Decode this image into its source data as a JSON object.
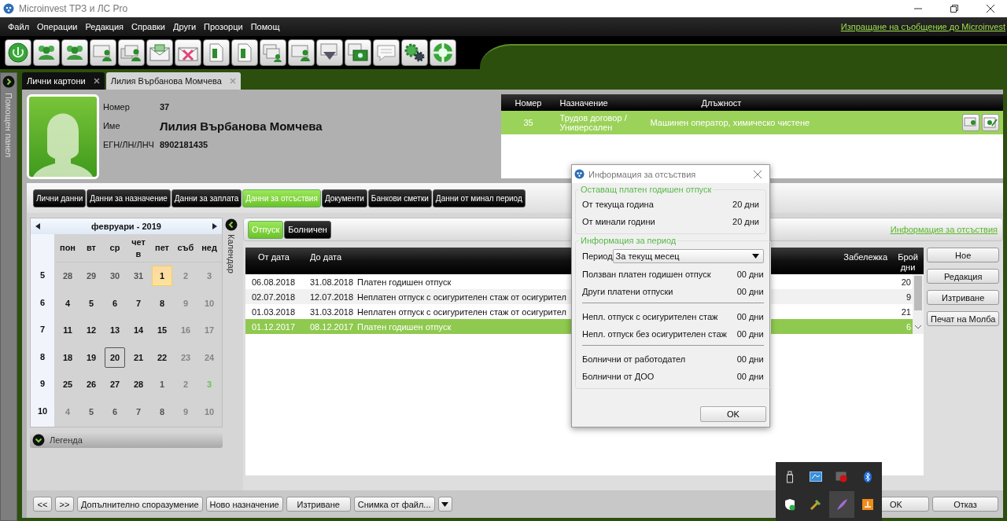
{
  "window": {
    "title": "Microinvest ТРЗ и ЛС Pro"
  },
  "menu": [
    "Файл",
    "Операции",
    "Редакция",
    "Справки",
    "Други",
    "Прозорци",
    "Помощ"
  ],
  "top_link": "Изпращане на съобщение до Microinvest",
  "side_panel": {
    "label": "Помощен панел"
  },
  "document_tabs": [
    {
      "label": "Лични картони",
      "selected": false
    },
    {
      "label": "Лилия Върбанова Момчева",
      "selected": true
    }
  ],
  "employee": {
    "fields": [
      {
        "label": "Номер",
        "value": "37",
        "kind": "plain"
      },
      {
        "label": "Име",
        "value": "Лилия Върбанова Момчева",
        "kind": "name"
      },
      {
        "label": "ЕГН/ЛН/ЛНЧ",
        "value": "8902181435",
        "kind": "plain"
      }
    ]
  },
  "assignments": {
    "columns": [
      "Номер",
      "Назначение",
      "Длъжност"
    ],
    "rows": [
      {
        "number": "35",
        "assignment": "Трудов договор / Универсален",
        "position": "Машинен оператор, химическо чистене",
        "selected": true
      }
    ]
  },
  "section_tabs": [
    {
      "label": "Лични данни",
      "selected": false
    },
    {
      "label": "Данни за назначение",
      "selected": false
    },
    {
      "label": "Данни за заплата",
      "selected": false
    },
    {
      "label": "Данни за отсъствия",
      "selected": true
    },
    {
      "label": "Документи",
      "selected": false
    },
    {
      "label": "Банкови сметки",
      "selected": false
    },
    {
      "label": "Данни от минал период",
      "selected": false
    }
  ],
  "calendar": {
    "title": "февруари - 2019",
    "toggle_label": "Календар",
    "legend": "Легенда",
    "weekdays": [
      "пон",
      "вт",
      "ср",
      "четв",
      "пет",
      "съб",
      "нед"
    ],
    "weeks": [
      {
        "number": "5",
        "days": [
          {
            "n": "28",
            "kind": "muted"
          },
          {
            "n": "29",
            "kind": "muted"
          },
          {
            "n": "30",
            "kind": "muted"
          },
          {
            "n": "31",
            "kind": "muted"
          },
          {
            "n": "1",
            "kind": "highlight"
          },
          {
            "n": "2",
            "kind": "faint"
          },
          {
            "n": "3",
            "kind": "faint"
          }
        ]
      },
      {
        "number": "6",
        "days": [
          {
            "n": "4",
            "kind": "normal"
          },
          {
            "n": "5",
            "kind": "normal"
          },
          {
            "n": "6",
            "kind": "normal"
          },
          {
            "n": "7",
            "kind": "normal"
          },
          {
            "n": "8",
            "kind": "normal"
          },
          {
            "n": "9",
            "kind": "faint"
          },
          {
            "n": "10",
            "kind": "faint"
          }
        ]
      },
      {
        "number": "7",
        "days": [
          {
            "n": "11",
            "kind": "normal"
          },
          {
            "n": "12",
            "kind": "normal"
          },
          {
            "n": "13",
            "kind": "normal"
          },
          {
            "n": "14",
            "kind": "normal"
          },
          {
            "n": "15",
            "kind": "normal"
          },
          {
            "n": "16",
            "kind": "faint"
          },
          {
            "n": "17",
            "kind": "faint"
          }
        ]
      },
      {
        "number": "8",
        "days": [
          {
            "n": "18",
            "kind": "normal"
          },
          {
            "n": "19",
            "kind": "normal"
          },
          {
            "n": "20",
            "kind": "today"
          },
          {
            "n": "21",
            "kind": "normal"
          },
          {
            "n": "22",
            "kind": "normal"
          },
          {
            "n": "23",
            "kind": "faint"
          },
          {
            "n": "24",
            "kind": "faint"
          }
        ]
      },
      {
        "number": "9",
        "days": [
          {
            "n": "25",
            "kind": "normal"
          },
          {
            "n": "26",
            "kind": "normal"
          },
          {
            "n": "27",
            "kind": "normal"
          },
          {
            "n": "28",
            "kind": "normal"
          },
          {
            "n": "1",
            "kind": "muted"
          },
          {
            "n": "2",
            "kind": "faint"
          },
          {
            "n": "3",
            "kind": "green"
          }
        ]
      },
      {
        "number": "10",
        "days": [
          {
            "n": "4",
            "kind": "faint"
          },
          {
            "n": "5",
            "kind": "muted"
          },
          {
            "n": "6",
            "kind": "muted"
          },
          {
            "n": "7",
            "kind": "muted"
          },
          {
            "n": "8",
            "kind": "muted"
          },
          {
            "n": "9",
            "kind": "faint"
          },
          {
            "n": "10",
            "kind": "faint"
          }
        ]
      }
    ]
  },
  "absence": {
    "tabs": [
      {
        "label": "Отпуск",
        "selected": true
      },
      {
        "label": "Болничен",
        "selected": false
      }
    ],
    "info_link": "Информация за отсъствия",
    "columns": [
      "От дата",
      "До дата",
      "Забележка",
      "Брой дни"
    ],
    "rows": [
      {
        "from": "06.08.2018",
        "to": "31.08.2018",
        "type": "Платен годишен отпуск",
        "days": "20",
        "selected": false
      },
      {
        "from": "02.07.2018",
        "to": "12.07.2018",
        "type": "Неплатен отпуск с осигурителен стаж от осигурител",
        "days": "9",
        "selected": false
      },
      {
        "from": "01.03.2018",
        "to": "31.03.2018",
        "type": "Неплатен отпуск с осигурителен стаж от осигурител",
        "days": "21",
        "selected": false
      },
      {
        "from": "01.12.2017",
        "to": "08.12.2017",
        "type": "Платен годишен отпуск",
        "days": "6",
        "selected": true
      }
    ],
    "actions": [
      "Ное",
      "Редакция",
      "Изтриване",
      "Печат на Молба"
    ]
  },
  "footer_buttons": [
    "<<",
    ">>",
    "Допълнително споразумение",
    "Ново назначение",
    "Изтриване",
    "Снимка от файл..."
  ],
  "dialog_buttons": [
    "OK",
    "Отказ"
  ],
  "dialog": {
    "title": "Информация за отсъствия",
    "remaining": {
      "title": "Оставащ платен годишен отпуск",
      "rows": [
        {
          "label": "От текуща година",
          "value": "20 дни"
        },
        {
          "label": "От минали години",
          "value": "20 дни"
        }
      ]
    },
    "period": {
      "title": "Информация за период",
      "label": "Период",
      "value": "За текущ месец",
      "groups": [
        [
          {
            "label": "Ползван платен годишен отпуск",
            "value": "00 дни"
          },
          {
            "label": "Други платени отпуски",
            "value": "00 дни"
          }
        ],
        [
          {
            "label": "Непл. отпуск с осигурителен стаж",
            "value": "00 дни"
          },
          {
            "label": "Непл. отпуск без осигурителен стаж",
            "value": "00 дни"
          }
        ],
        [
          {
            "label": "Болнични от работодател",
            "value": "00 дни"
          },
          {
            "label": "Болнични от ДОО",
            "value": "00 дни"
          }
        ]
      ]
    },
    "ok": "OK"
  }
}
